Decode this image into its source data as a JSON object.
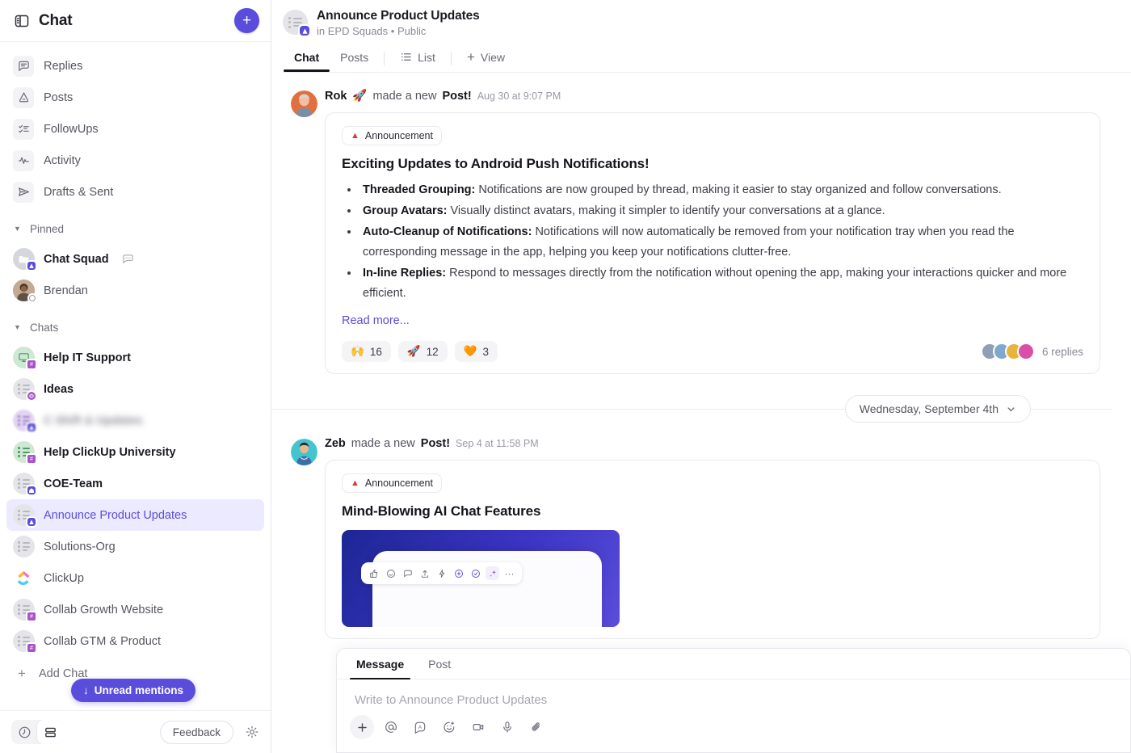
{
  "sidebar": {
    "title": "Chat",
    "panel_icon": "panel-toggle-icon",
    "add_button": "+",
    "nav_items": [
      {
        "label": "Replies",
        "icon": "replies-icon"
      },
      {
        "label": "Posts",
        "icon": "megaphone-icon"
      },
      {
        "label": "FollowUps",
        "icon": "checklist-icon"
      },
      {
        "label": "Activity",
        "icon": "activity-pulse-icon"
      },
      {
        "label": "Drafts & Sent",
        "icon": "send-icon"
      }
    ],
    "sections": [
      {
        "label": "Pinned",
        "items": [
          {
            "label": "Chat Squad",
            "bold": true,
            "blurred": false,
            "avatar_color": "#d6d6dd",
            "badge_color": "#5b4ddb",
            "badge_icon": "announcement-badge",
            "trailing_icon": "comment-dots-icon",
            "kind": "folder",
            "photo": false
          },
          {
            "label": "Brendan",
            "bold": false,
            "blurred": false,
            "avatar_color": "#b9a089",
            "badge_color": "#ffffff",
            "badge_icon": "status-offline-badge",
            "kind": "person",
            "photo": true
          }
        ]
      },
      {
        "label": "Chats",
        "items": [
          {
            "label": "Help IT Support",
            "bold": true,
            "blurred": false,
            "avatar_color": "#cfe8d4",
            "badge_color": "#a855c9",
            "badge_icon": "hash-badge",
            "kind": "monitor",
            "photo": false
          },
          {
            "label": "Ideas",
            "bold": true,
            "blurred": false,
            "avatar_color": "#e4e4e9",
            "badge_color": "#a855c9",
            "badge_icon": "power-badge",
            "kind": "list",
            "photo": false
          },
          {
            "label": "C Shift & Updates",
            "bold": true,
            "blurred": true,
            "avatar_color": "#e2d4f2",
            "badge_color": "#5b4ddb",
            "badge_icon": "announcement-badge",
            "kind": "list",
            "photo": false
          },
          {
            "label": "Help ClickUp University",
            "bold": true,
            "blurred": false,
            "avatar_color": "#cfe8d4",
            "badge_color": "#a855c9",
            "badge_icon": "hash-badge",
            "kind": "list",
            "photo": false
          },
          {
            "label": "COE-Team",
            "bold": true,
            "blurred": false,
            "avatar_color": "#e4e4e9",
            "badge_color": "#5b4ddb",
            "badge_icon": "home-badge",
            "kind": "list",
            "photo": false
          },
          {
            "label": "Announce Product Updates",
            "bold": false,
            "blurred": false,
            "active": true,
            "avatar_color": "#e4e4e9",
            "badge_color": "#5b4ddb",
            "badge_icon": "announcement-badge",
            "kind": "list",
            "photo": false
          },
          {
            "label": "Solutions-Org",
            "bold": false,
            "blurred": false,
            "avatar_color": "#e4e4e9",
            "badge_color": "",
            "badge_icon": "",
            "kind": "list",
            "photo": false
          },
          {
            "label": "ClickUp",
            "bold": false,
            "blurred": false,
            "avatar_color": "#ffffff",
            "badge_color": "",
            "badge_icon": "",
            "kind": "clickup-logo",
            "photo": false
          },
          {
            "label": "Collab Growth Website",
            "bold": false,
            "blurred": false,
            "avatar_color": "#e4e4e9",
            "badge_color": "#a855c9",
            "badge_icon": "hash-badge",
            "kind": "list",
            "photo": false
          },
          {
            "label": "Collab GTM & Product",
            "bold": false,
            "blurred": false,
            "avatar_color": "#e4e4e9",
            "badge_color": "#a855c9",
            "badge_icon": "hash-badge",
            "kind": "list",
            "photo": false
          }
        ]
      }
    ],
    "add_chat_label": "Add Chat",
    "unread_pill": {
      "label": "Unread mentions",
      "arrow": "↓",
      "color": "#5b4ddb"
    },
    "footer": {
      "history_icon": "clock-icon",
      "layout_icon": "rows-layout-icon",
      "feedback_label": "Feedback",
      "settings_icon": "gear-icon"
    }
  },
  "header": {
    "title": "Announce Product Updates",
    "subtitle": "in EPD Squads • Public",
    "avatar_badge": "announcement-badge",
    "tabs": [
      {
        "label": "Chat",
        "active": true,
        "icon": ""
      },
      {
        "label": "Posts",
        "active": false,
        "icon": ""
      },
      {
        "label": "List",
        "active": false,
        "icon": "list-icon"
      },
      {
        "label": "View",
        "active": false,
        "icon": "plus-icon"
      }
    ]
  },
  "feed": {
    "posts": [
      {
        "author": "Rok",
        "author_emoji": "🚀",
        "action": "made a new",
        "action_bold": "Post!",
        "time": "Aug 30 at 9:07 PM",
        "avatar_color": "#e0713f",
        "chip": {
          "icon": "📌",
          "label": "Announcement"
        },
        "title": "Exciting Updates to Android Push Notifications!",
        "bullets": [
          {
            "bold": "Threaded Grouping:",
            "text": " Notifications are now grouped by thread, making it easier to stay organized and follow conversations."
          },
          {
            "bold": "Group Avatars:",
            "text": " Visually distinct avatars, making it simpler to identify your conversations at a glance."
          },
          {
            "bold": "Auto-Cleanup of Notifications:",
            "text": " Notifications will now automatically be removed from your notification tray when you read the corresponding message in the app, helping you keep your notifications clutter-free."
          },
          {
            "bold": "In-line Replies:",
            "text": " Respond to messages directly from the notification without opening the app, making your interactions quicker and more efficient."
          }
        ],
        "read_more": "Read more...",
        "reactions": [
          {
            "emoji": "🙌",
            "count": "16"
          },
          {
            "emoji": "🚀",
            "count": "12"
          },
          {
            "emoji": "🧡",
            "count": "3"
          }
        ],
        "replies_text": "6 replies",
        "reply_avatars": [
          "#8ea0b5",
          "#7fa8cf",
          "#e8b43c",
          "#d94fa8"
        ]
      },
      {
        "author": "Zeb",
        "author_emoji": "",
        "action": "made a new",
        "action_bold": "Post!",
        "time": "Sep 4 at 11:58 PM",
        "avatar_color": "#45c4cf",
        "chip": {
          "icon": "📌",
          "label": "Announcement"
        },
        "title": "Mind-Blowing AI Chat Features",
        "bullets": [],
        "read_more": "",
        "reactions": [],
        "replies_text": "",
        "reply_avatars": [],
        "embed": {
          "toolbar_icons": [
            "thumbs-up-icon",
            "emoji-icon",
            "comment-icon",
            "upload-icon",
            "lightning-icon",
            "plus-circle-icon",
            "check-circle-icon",
            "ai-sparkle-icon",
            "more-icon"
          ]
        }
      }
    ],
    "date_divider": {
      "label": "Wednesday, September 4th",
      "chevron": "chevron-down-icon"
    }
  },
  "composer": {
    "tabs": [
      {
        "label": "Message",
        "active": true
      },
      {
        "label": "Post",
        "active": false
      }
    ],
    "placeholder": "Write to Announce Product Updates",
    "tools": [
      "plus-icon",
      "mention-icon",
      "text-style-icon",
      "emoji-icon",
      "video-icon",
      "microphone-icon",
      "attachment-icon"
    ]
  },
  "colors": {
    "accent": "#5b4ddb",
    "active_bg": "#eceaff",
    "text_primary": "#15151c",
    "text_secondary": "#6a6a76",
    "border": "#e9e9ef"
  }
}
